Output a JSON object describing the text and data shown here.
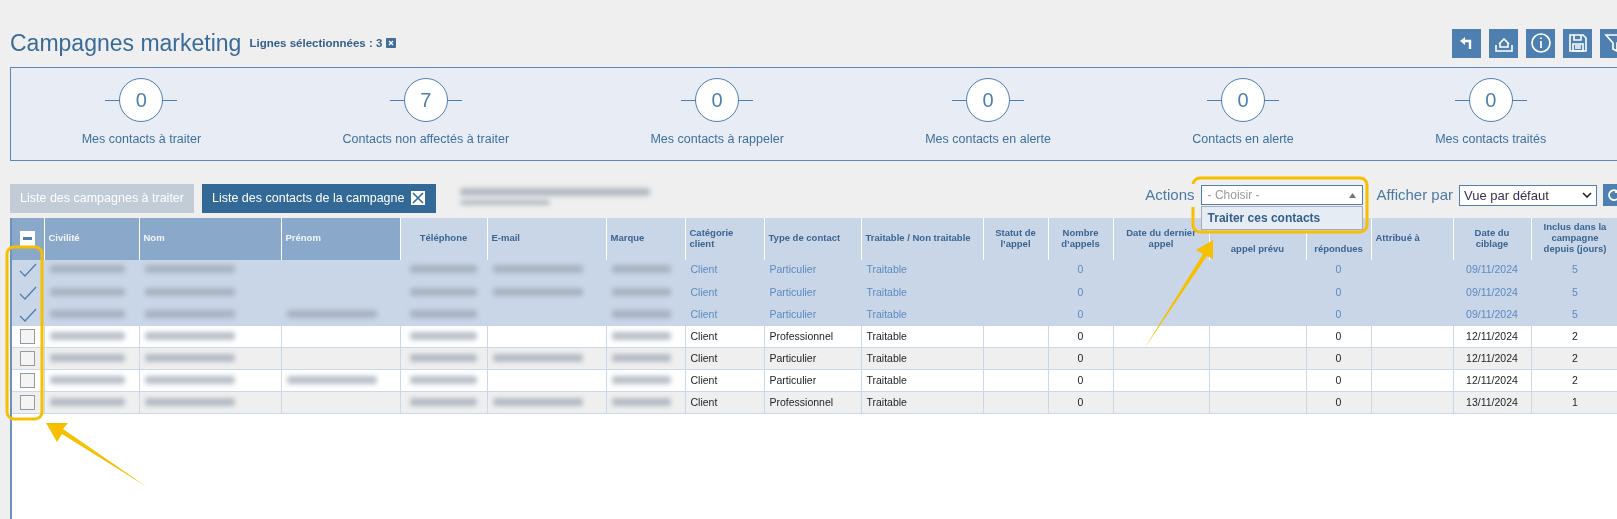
{
  "page": {
    "title": "Campagnes marketing",
    "selection_label": "Lignes sélectionnées : 3"
  },
  "kpis": [
    {
      "value": "0",
      "label": "Mes contacts à traiter"
    },
    {
      "value": "7",
      "label": "Contacts non affectés à traiter"
    },
    {
      "value": "0",
      "label": "Mes contacts à rappeler"
    },
    {
      "value": "0",
      "label": "Mes contacts en alerte"
    },
    {
      "value": "0",
      "label": "Contacts en alerte"
    },
    {
      "value": "0",
      "label": "Mes contacts traités"
    }
  ],
  "tabs": [
    {
      "label": "Liste des campagnes à traiter",
      "selected": false,
      "closable": false
    },
    {
      "label": "Liste des contacts de la campagne",
      "selected": true,
      "closable": true
    }
  ],
  "actions": {
    "label": "Actions",
    "placeholder": "- Choisir -",
    "expanded": true,
    "options": [
      {
        "label": "Traiter ces contacts",
        "selected": true
      }
    ]
  },
  "view": {
    "label": "Afficher par",
    "value": "Vue par défaut"
  },
  "table": {
    "select_all_partial": true,
    "columns": [
      "Civilité",
      "Nom",
      "Prénom",
      "Téléphone",
      "E-mail",
      "Marque",
      "Catégorie client",
      "Type de contact",
      "Traitable / Non traitable",
      "Statut de l’appel",
      "Nombre d’appels",
      "Date du dernier appel",
      "appel prévu",
      "répondues",
      "Attribué à",
      "Date du ciblage",
      "Inclus dans la campagne depuis (jours)"
    ],
    "rows": [
      {
        "selected": true,
        "cells": [
          {
            "blurred": true
          },
          {
            "blurred": true
          },
          null,
          {
            "blurred": true
          },
          {
            "blurred": true
          },
          {
            "blurred": true
          },
          "Client",
          "Particulier",
          "Traitable",
          null,
          "0",
          null,
          null,
          "0",
          null,
          "09/11/2024",
          "5"
        ]
      },
      {
        "selected": true,
        "cells": [
          {
            "blurred": true
          },
          {
            "blurred": true
          },
          null,
          {
            "blurred": true
          },
          {
            "blurred": true
          },
          {
            "blurred": true
          },
          "Client",
          "Particulier",
          "Traitable",
          null,
          "0",
          null,
          null,
          "0",
          null,
          "09/11/2024",
          "5"
        ]
      },
      {
        "selected": true,
        "cells": [
          {
            "blurred": true
          },
          {
            "blurred": true
          },
          {
            "blurred": true
          },
          {
            "blurred": true
          },
          null,
          {
            "blurred": true
          },
          "Client",
          "Particulier",
          "Traitable",
          null,
          "0",
          null,
          null,
          "0",
          null,
          "09/11/2024",
          "5"
        ]
      },
      {
        "selected": false,
        "cells": [
          {
            "blurred": true
          },
          {
            "blurred": true
          },
          null,
          {
            "blurred": true
          },
          null,
          {
            "blurred": true
          },
          "Client",
          "Professionnel",
          "Traitable",
          null,
          "0",
          null,
          null,
          "0",
          null,
          "12/11/2024",
          "2"
        ]
      },
      {
        "selected": false,
        "cells": [
          {
            "blurred": true
          },
          {
            "blurred": true
          },
          null,
          {
            "blurred": true
          },
          {
            "blurred": true
          },
          {
            "blurred": true
          },
          "Client",
          "Particulier",
          "Traitable",
          null,
          "0",
          null,
          null,
          "0",
          null,
          "12/11/2024",
          "2"
        ]
      },
      {
        "selected": false,
        "cells": [
          {
            "blurred": true
          },
          {
            "blurred": true
          },
          {
            "blurred": true
          },
          {
            "blurred": true
          },
          null,
          {
            "blurred": true
          },
          "Client",
          "Particulier",
          "Traitable",
          null,
          "0",
          null,
          null,
          "0",
          null,
          "12/11/2024",
          "2"
        ]
      },
      {
        "selected": false,
        "cells": [
          {
            "blurred": true
          },
          {
            "blurred": true
          },
          null,
          {
            "blurred": true
          },
          {
            "blurred": true
          },
          {
            "blurred": true
          },
          "Client",
          "Professionnel",
          "Traitable",
          null,
          "0",
          null,
          null,
          "0",
          null,
          "13/11/2024",
          "1"
        ]
      }
    ]
  }
}
